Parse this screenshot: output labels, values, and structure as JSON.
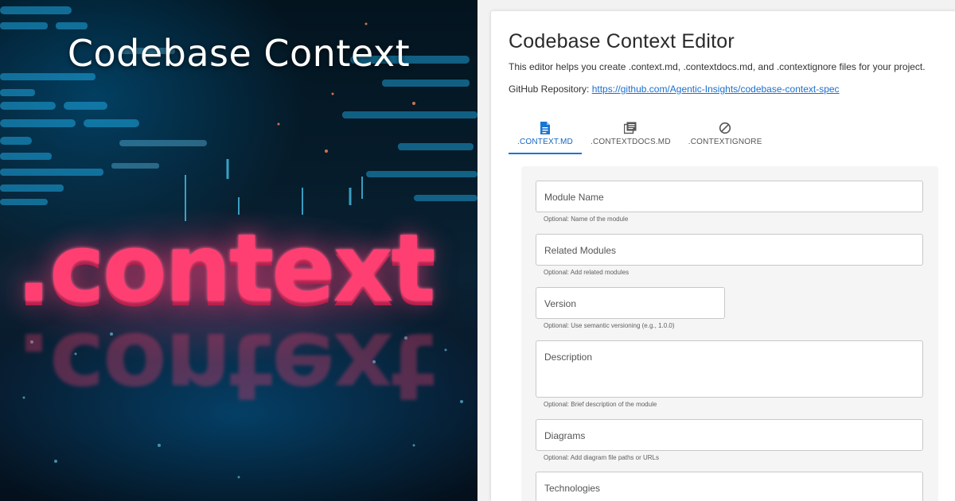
{
  "hero": {
    "title": "Codebase Context",
    "word": ".context"
  },
  "editor": {
    "title": "Codebase Context Editor",
    "intro": "This editor helps you create .context.md, .contextdocs.md, and .contextignore files for your project.",
    "repo_label": "GitHub Repository:",
    "repo_link": "https://github.com/Agentic-Insights/codebase-context-spec",
    "tabs": [
      {
        "label": ".CONTEXT.MD",
        "icon": "document-icon",
        "active": true
      },
      {
        "label": ".CONTEXTDOCS.MD",
        "icon": "library-icon",
        "active": false
      },
      {
        "label": ".CONTEXTIGNORE",
        "icon": "block-icon",
        "active": false
      }
    ],
    "fields": [
      {
        "placeholder": "Module Name",
        "helper": "Optional: Name of the module"
      },
      {
        "placeholder": "Related Modules",
        "helper": "Optional: Add related modules"
      },
      {
        "placeholder": "Version",
        "helper": "Optional: Use semantic versioning (e.g., 1.0.0)"
      },
      {
        "placeholder": "Description",
        "helper": "Optional: Brief description of the module"
      },
      {
        "placeholder": "Diagrams",
        "helper": "Optional: Add diagram file paths or URLs"
      },
      {
        "placeholder": "Technologies",
        "helper": ""
      }
    ]
  },
  "colors": {
    "accent": "#1976d2",
    "link": "#1a6fd1",
    "hero_word": "#ff3f72"
  }
}
